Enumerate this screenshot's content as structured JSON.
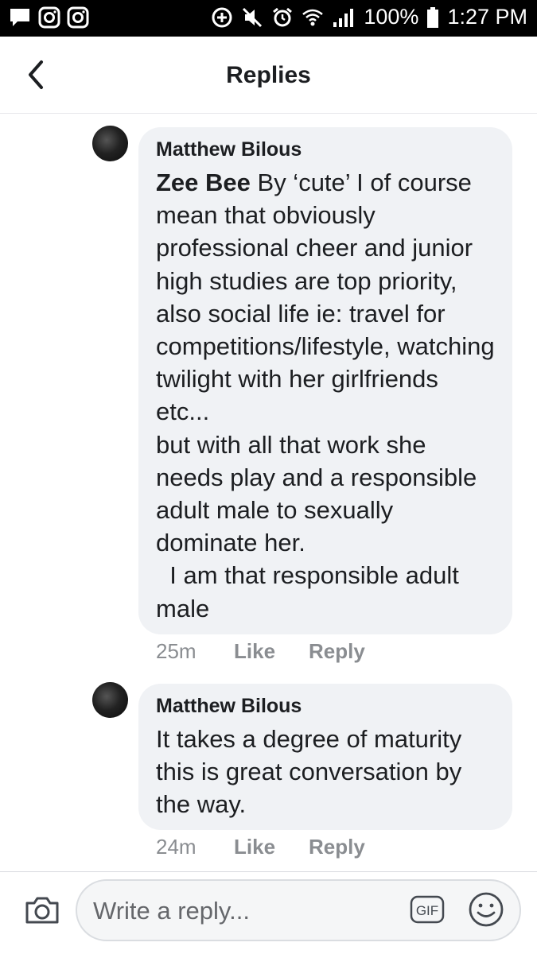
{
  "status_bar": {
    "battery": "100%",
    "time": "1:27 PM"
  },
  "header": {
    "title": "Replies"
  },
  "comments": [
    {
      "author": "Matthew Bilous",
      "mention": "Zee Bee",
      "text_after_mention": " By ‘cute’ I of course mean that obviously professional cheer and junior high studies are top priority, also social life ie: travel for competitions/lifestyle, watching twilight with her girlfriends etc...",
      "paragraphs": [
        "but with all that work she needs play and a responsible adult male to sexually dominate her.",
        "  I am that responsible adult male"
      ],
      "time": "25m",
      "like_label": "Like",
      "reply_label": "Reply"
    },
    {
      "author": "Matthew Bilous",
      "text": "It takes a degree of maturity this is great conversation by the way.",
      "time": "24m",
      "like_label": "Like",
      "reply_label": "Reply"
    }
  ],
  "composer": {
    "placeholder": "Write a reply...",
    "gif_label": "GIF"
  },
  "icons": {
    "status_left": [
      "messenger-icon",
      "instagram-icon",
      "instagram-icon"
    ],
    "status_right": [
      "data-saver-icon",
      "mute-icon",
      "alarm-icon",
      "wifi-icon",
      "signal-icon",
      "battery-icon"
    ],
    "header": [
      "back-chevron-icon"
    ],
    "composer": [
      "camera-icon",
      "gif-icon",
      "emoji-icon"
    ]
  },
  "colors": {
    "bubble_background": "#f0f2f5",
    "meta_text": "#8a8d91",
    "primary_text": "#1c1e21"
  }
}
